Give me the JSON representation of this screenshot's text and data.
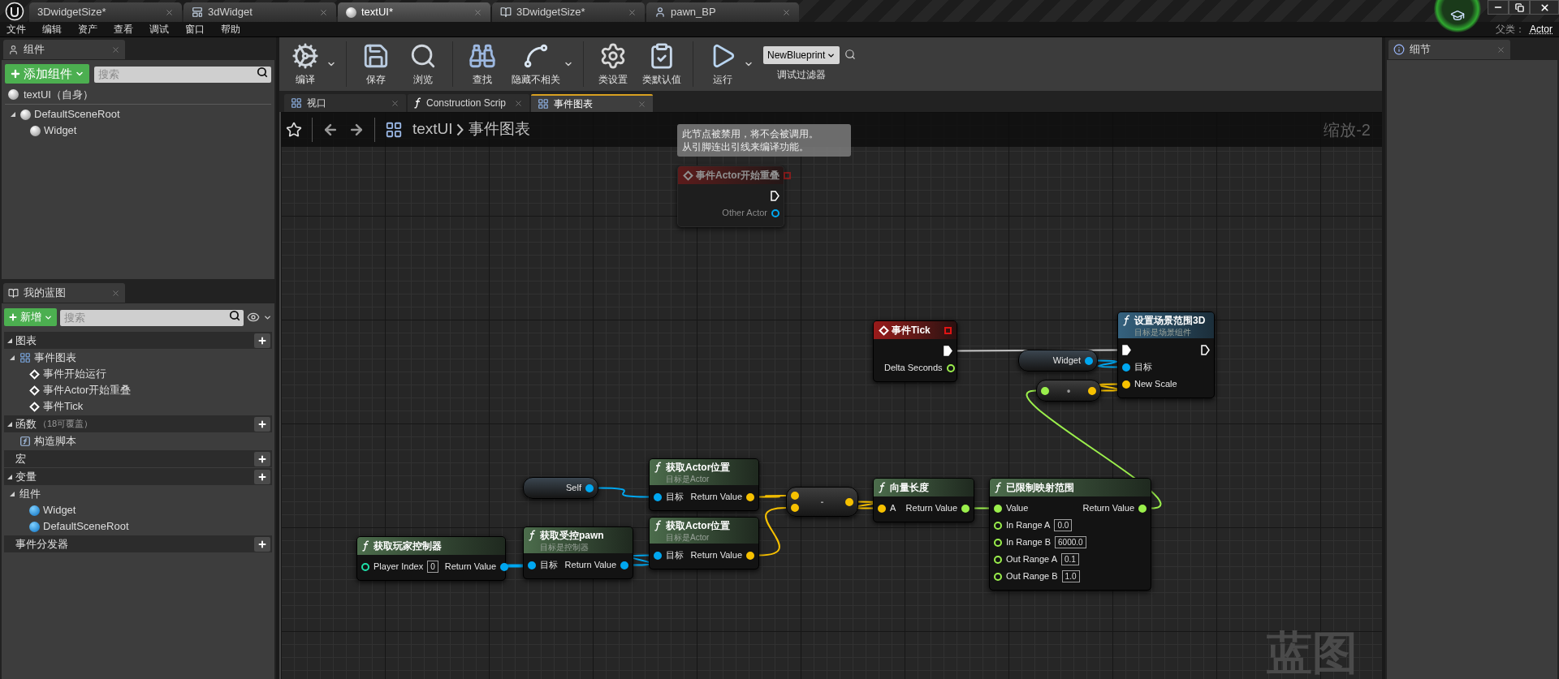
{
  "title_bar": {
    "tabs": [
      {
        "label": "3DwidgetSize*",
        "kind": "plain",
        "selected": false
      },
      {
        "label": "3dWidget",
        "kind": "widget",
        "selected": false
      },
      {
        "label": "textUI*",
        "kind": "actor",
        "selected": true
      },
      {
        "label": "3DwidgetSize*",
        "kind": "level",
        "selected": false
      },
      {
        "label": "pawn_BP",
        "kind": "pawn",
        "selected": false
      }
    ]
  },
  "menu": [
    "文件",
    "编辑",
    "资产",
    "查看",
    "调试",
    "窗口",
    "帮助"
  ],
  "parent_class": {
    "label": "父类：",
    "value": "Actor"
  },
  "components_panel": {
    "tab": "组件",
    "add_button": "添加组件",
    "search": {
      "placeholder": "搜索"
    },
    "self_item": "textUI（自身）",
    "tree": [
      {
        "label": "DefaultSceneRoot",
        "expanded": true,
        "children": [
          {
            "label": "Widget"
          }
        ]
      }
    ]
  },
  "my_blueprint": {
    "tab": "我的蓝图",
    "add_button": "新增",
    "search": {
      "placeholder": "搜索"
    },
    "sections": [
      {
        "label": "图表",
        "expanded": true,
        "items": [
          {
            "label": "事件图表",
            "kind": "graph",
            "expanded": true,
            "children": [
              {
                "label": "事件开始运行",
                "kind": "event"
              },
              {
                "label": "事件Actor开始重叠",
                "kind": "event"
              },
              {
                "label": "事件Tick",
                "kind": "event"
              }
            ]
          }
        ]
      },
      {
        "label": "函数",
        "note": "（18可覆盖）",
        "expanded": true,
        "items": [
          {
            "label": "构造脚本",
            "kind": "function"
          }
        ]
      },
      {
        "label": "宏"
      },
      {
        "label": "变量",
        "expanded": true,
        "items": [
          {
            "label": "组件",
            "kind": "category",
            "expanded": true,
            "children": [
              {
                "label": "Widget",
                "kind": "component"
              },
              {
                "label": "DefaultSceneRoot",
                "kind": "component"
              }
            ]
          }
        ]
      },
      {
        "label": "事件分发器"
      }
    ]
  },
  "toolbar": {
    "buttons": [
      {
        "label": "编译",
        "kind": "compile",
        "dropdown": true
      },
      {
        "label": "保存",
        "kind": "save",
        "dropdown": false
      },
      {
        "label": "浏览",
        "kind": "browse",
        "dropdown": false
      },
      {
        "label": "查找",
        "kind": "find",
        "dropdown": false
      },
      {
        "label": "隐藏不相关",
        "kind": "hide",
        "dropdown": true
      },
      {
        "label": "类设置",
        "kind": "class_settings",
        "dropdown": false
      },
      {
        "label": "类默认值",
        "kind": "class_defaults",
        "dropdown": false
      },
      {
        "label": "运行",
        "kind": "run",
        "dropdown": true
      }
    ],
    "debug_filter": {
      "value": "NewBlueprint",
      "label": "调试过滤器"
    }
  },
  "graph_tabs": [
    {
      "label": "视口",
      "kind": "viewport",
      "selected": false
    },
    {
      "label": "Construction Scrip",
      "kind": "function",
      "selected": false
    },
    {
      "label": "事件图表",
      "kind": "graph",
      "selected": true
    }
  ],
  "breadcrumb": {
    "blueprint": "textUI",
    "graph": "事件图表"
  },
  "zoom_label": "缩放-2",
  "graph_type_label": "蓝图",
  "comment_bubble": [
    "此节点被禁用，将不会被调用。",
    "从引脚连出引线来编译功能。"
  ],
  "nodes": [
    {
      "kind": "event",
      "title": "事件Actor开始重叠",
      "disabled": true,
      "outputs": [
        {
          "kind": "exec",
          "connected": false
        },
        {
          "label": "Other Actor",
          "kind": "data",
          "color": "#00a7f0",
          "connected": false
        }
      ]
    },
    {
      "kind": "event",
      "title": "事件Tick",
      "disabled": false,
      "outputs": [
        {
          "kind": "exec",
          "connected": true
        },
        {
          "label": "Delta Seconds",
          "kind": "data",
          "color": "#9bef4c",
          "connected": false
        }
      ]
    },
    {
      "kind": "variable",
      "outputs": [
        {
          "label": "Widget",
          "kind": "data",
          "color": "#00a7f0",
          "connected": true
        }
      ]
    },
    {
      "kind": "function",
      "title": "设置场景范围3D",
      "subtitle": "目标是场景组件",
      "inputs": [
        {
          "kind": "exec",
          "connected": true
        },
        {
          "label": "目标",
          "kind": "data",
          "color": "#00a7f0",
          "connected": true
        },
        {
          "label": "New Scale",
          "kind": "data",
          "color": "#f7c100",
          "connected": true
        }
      ],
      "outputs": [
        {
          "kind": "exec",
          "connected": false
        }
      ]
    },
    {
      "kind": "operator",
      "title": "•",
      "inputs": [
        {
          "kind": "data",
          "color": "#9bef4c",
          "connected": true
        }
      ],
      "outputs": [
        {
          "kind": "data",
          "color": "#f7c100",
          "connected": true
        }
      ]
    },
    {
      "kind": "variable",
      "outputs": [
        {
          "label": "Self",
          "kind": "data",
          "color": "#00a7f0",
          "connected": true
        }
      ]
    },
    {
      "kind": "pure_function",
      "title": "获取Actor位置",
      "subtitle": "目标是Actor",
      "inputs": [
        {
          "label": "目标",
          "kind": "data",
          "color": "#00a7f0",
          "connected": true
        }
      ],
      "outputs": [
        {
          "label": "Return Value",
          "kind": "data",
          "color": "#f7c100",
          "connected": true
        }
      ]
    },
    {
      "kind": "operator",
      "title": "-",
      "inputs": [
        {
          "kind": "data",
          "color": "#f7c100",
          "connected": true
        },
        {
          "kind": "data",
          "color": "#f7c100",
          "connected": true
        }
      ],
      "outputs": [
        {
          "kind": "data",
          "color": "#f7c100",
          "connected": true
        }
      ]
    },
    {
      "kind": "pure_function",
      "title": "向量长度",
      "inputs": [
        {
          "label": "A",
          "kind": "data",
          "color": "#f7c100",
          "connected": true
        }
      ],
      "outputs": [
        {
          "label": "Return Value",
          "kind": "data",
          "color": "#9bef4c",
          "connected": true
        }
      ]
    },
    {
      "kind": "pure_function",
      "title": "已限制映射范围",
      "inputs": [
        {
          "label": "Value",
          "kind": "data",
          "color": "#9bef4c",
          "connected": true
        },
        {
          "label": "In Range A",
          "kind": "data",
          "color": "#9bef4c",
          "connected": false,
          "value": "0.0"
        },
        {
          "label": "In Range B",
          "kind": "data",
          "color": "#9bef4c",
          "connected": false,
          "value": "6000.0"
        },
        {
          "label": "Out Range A",
          "kind": "data",
          "color": "#9bef4c",
          "connected": false,
          "value": "0.1"
        },
        {
          "label": "Out Range B",
          "kind": "data",
          "color": "#9bef4c",
          "connected": false,
          "value": "1.0"
        }
      ],
      "outputs": [
        {
          "label": "Return Value",
          "kind": "data",
          "color": "#9bef4c",
          "connected": true
        }
      ]
    },
    {
      "kind": "pure_function",
      "title": "获取玩家控制器",
      "inputs": [
        {
          "label": "Player Index",
          "kind": "data",
          "color": "#1fe0aa",
          "connected": false,
          "value": "0"
        }
      ],
      "outputs": [
        {
          "label": "Return Value",
          "kind": "data",
          "color": "#00a7f0",
          "connected": true
        }
      ]
    },
    {
      "kind": "pure_function",
      "title": "获取受控pawn",
      "subtitle": "目标是控制器",
      "inputs": [
        {
          "label": "目标",
          "kind": "data",
          "color": "#00a7f0",
          "connected": true
        }
      ],
      "outputs": [
        {
          "label": "Return Value",
          "kind": "data",
          "color": "#00a7f0",
          "connected": true
        }
      ]
    },
    {
      "kind": "pure_function",
      "title": "获取Actor位置",
      "subtitle": "目标是Actor",
      "inputs": [
        {
          "label": "目标",
          "kind": "data",
          "color": "#00a7f0",
          "connected": true
        }
      ],
      "outputs": [
        {
          "label": "Return Value",
          "kind": "data",
          "color": "#f7c100",
          "connected": true
        }
      ]
    }
  ],
  "details_panel": {
    "tab": "细节"
  }
}
